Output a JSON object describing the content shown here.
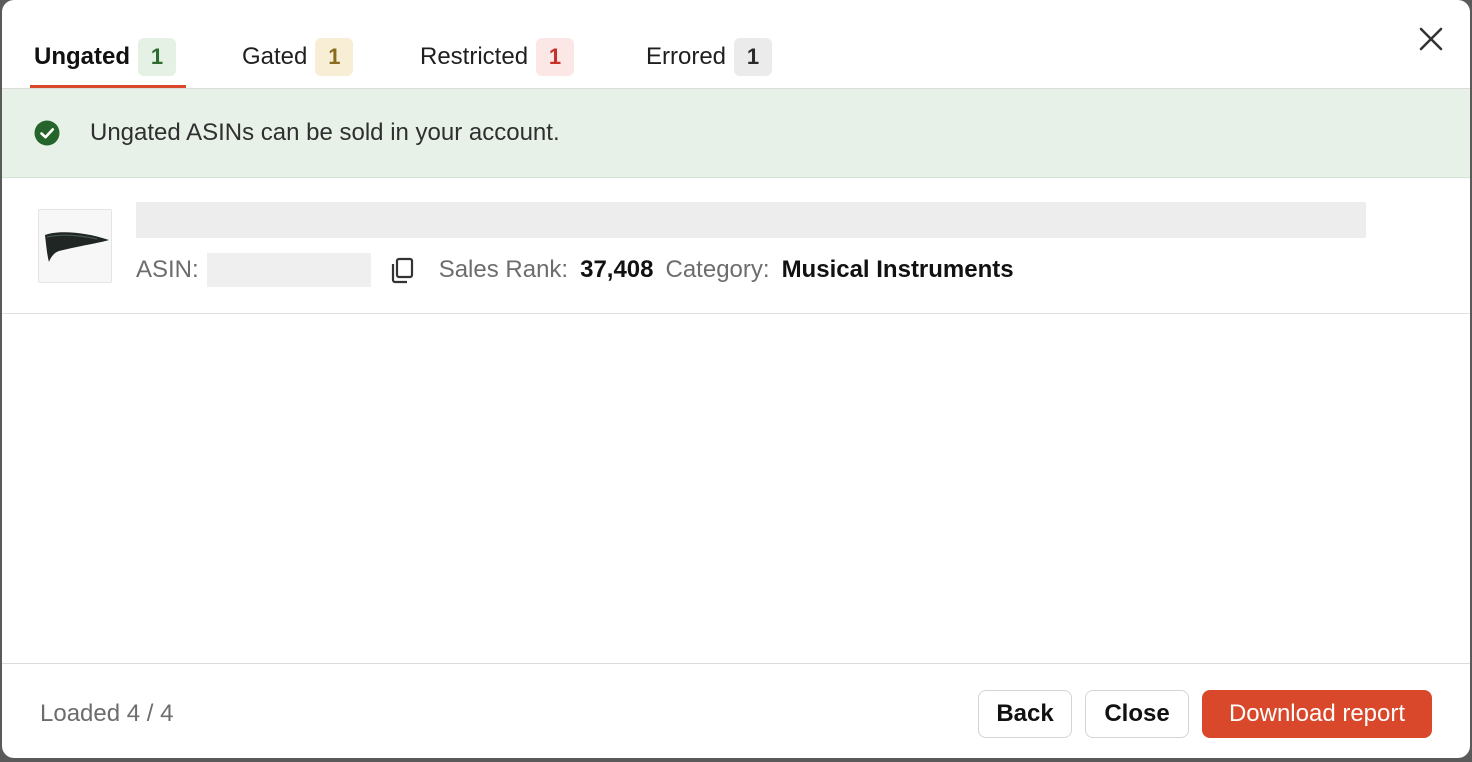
{
  "tabs": [
    {
      "label": "Ungated",
      "count": "1",
      "color": "#2e6b2e"
    },
    {
      "label": "Gated",
      "count": "1",
      "color": "#8a6a1e"
    },
    {
      "label": "Restricted",
      "count": "1",
      "color": "#c8302a"
    },
    {
      "label": "Errored",
      "count": "1",
      "color": "#2a2a2a"
    }
  ],
  "active_tab": "Ungated",
  "banner": {
    "icon": "check-circle-icon",
    "message": "Ungated ASINs can be sold in your account."
  },
  "item": {
    "asin_label": "ASIN:",
    "sales_rank_label": "Sales Rank:",
    "sales_rank": "37,408",
    "category_label": "Category:",
    "category": "Musical Instruments"
  },
  "footer": {
    "loaded_text": "Loaded 4 / 4",
    "back_label": "Back",
    "close_label": "Close",
    "download_label": "Download report"
  },
  "colors": {
    "accent": "#d9482b",
    "banner_bg": "#e7f1e8",
    "success": "#2e6b2e"
  }
}
